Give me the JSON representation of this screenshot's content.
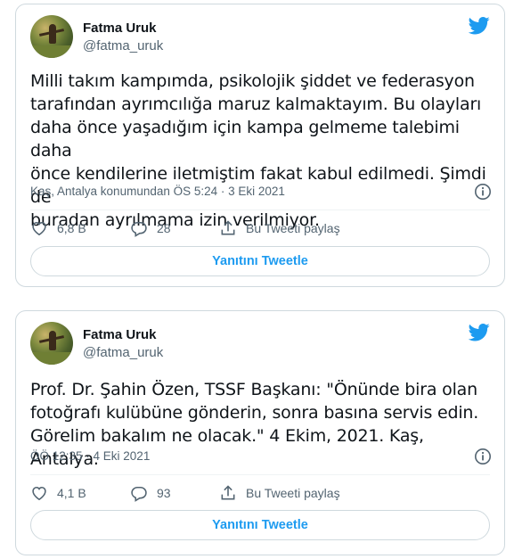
{
  "tweets": [
    {
      "author": {
        "name": "Fatma Uruk",
        "handle": "@fatma_uruk"
      },
      "text_lines": [
        "Milli takım kampımda, psikolojik şiddet ve federasyon",
        "tarafından ayrımcılığa maruz kalmaktayım. Bu olayları",
        "daha önce yaşadığım için kampa gelmeme talebimi daha",
        "önce kendilerine iletmiştim fakat kabul edilmedi. Şimdi de",
        "buradan ayrılmama izin verilmiyor."
      ],
      "meta": "Kaş, Antalya konumundan ÖS 5:24 · 3 Eki 2021",
      "likes": "6,8 B",
      "replies": "28",
      "share_label": "Bu Tweeti paylaş",
      "reply_button": "Yanıtını Tweetle"
    },
    {
      "author": {
        "name": "Fatma Uruk",
        "handle": "@fatma_uruk"
      },
      "text_lines": [
        "Prof. Dr. Şahin Özen, TSSF Başkanı: \"Önünde bira olan",
        "fotoğrafı kulübüne gönderin, sonra basına servis edin.",
        "Görelim bakalım ne olacak.\" 4 Ekim, 2021. Kaş, Antalya."
      ],
      "meta": "ÖÖ 12:35 · 4 Eki 2021",
      "likes": "4,1 B",
      "replies": "93",
      "share_label": "Bu Tweeti paylaş",
      "reply_button": "Yanıtını Tweetle"
    }
  ],
  "icons": {
    "bird": "twitter-bird-icon",
    "info": "info-icon",
    "like": "heart-icon",
    "reply": "comment-icon",
    "share": "share-icon"
  },
  "colors": {
    "accent": "#1d9bf0",
    "text": "#0f1419",
    "secondary": "#536471",
    "border": "#cfd9de"
  }
}
